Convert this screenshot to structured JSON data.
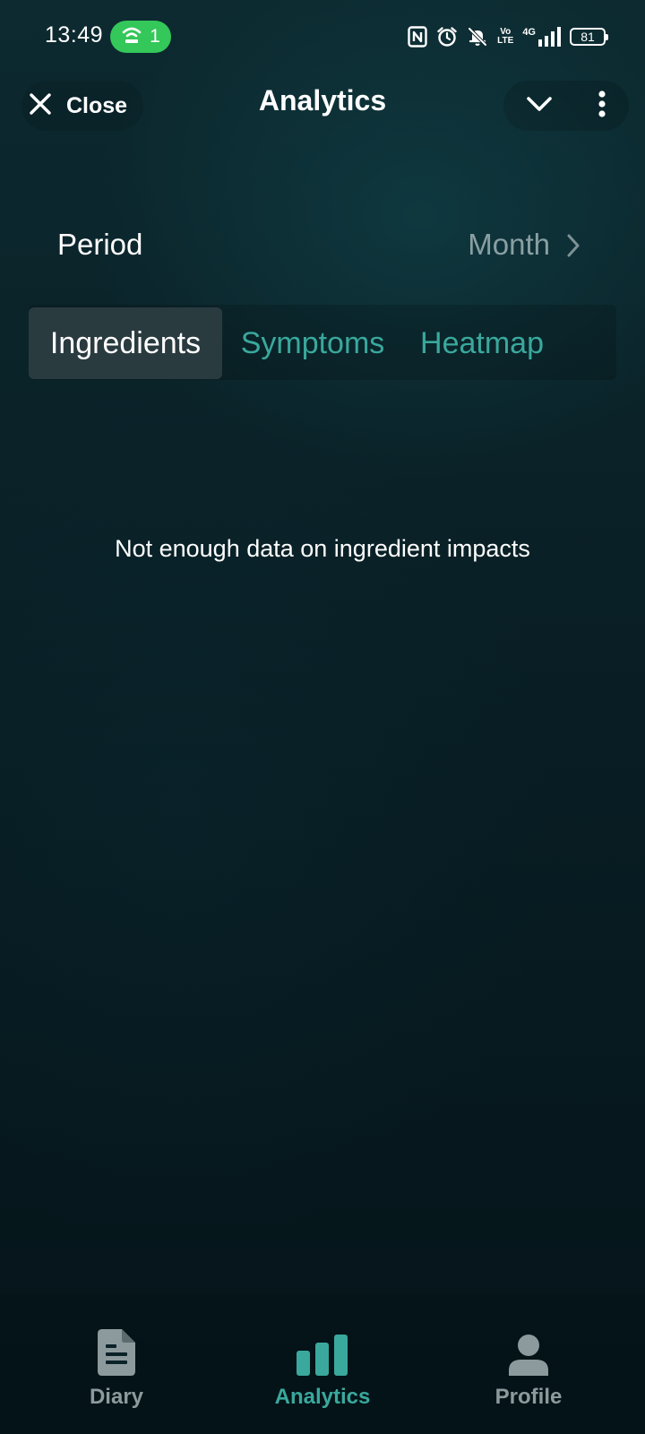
{
  "status_bar": {
    "time": "13:49",
    "hotspot_count": "1",
    "volte_top": "Vo",
    "volte_bottom": "LTE",
    "network": "4G",
    "battery": "81",
    "icons": [
      "nfc-icon",
      "alarm-icon",
      "bell-muted-icon",
      "volte-icon",
      "signal-icon",
      "battery-icon"
    ]
  },
  "header": {
    "close_label": "Close",
    "title": "Analytics",
    "icons": [
      "close-icon",
      "chevron-down-icon",
      "more-vertical-icon"
    ]
  },
  "period": {
    "label": "Period",
    "value": "Month"
  },
  "tabs": [
    {
      "label": "Ingredients",
      "active": true
    },
    {
      "label": "Symptoms",
      "active": false
    },
    {
      "label": "Heatmap",
      "active": false
    }
  ],
  "empty_state": {
    "message": "Not enough data on ingredient impacts"
  },
  "bottom_nav": {
    "items": [
      {
        "label": "Diary",
        "icon": "document-icon",
        "active": false
      },
      {
        "label": "Analytics",
        "icon": "bar-chart-icon",
        "active": true
      },
      {
        "label": "Profile",
        "icon": "person-icon",
        "active": false
      }
    ]
  },
  "colors": {
    "accent": "#3aa89d",
    "hotspot": "#34c759",
    "muted": "#8a9fa3",
    "background": "#0a2228"
  }
}
